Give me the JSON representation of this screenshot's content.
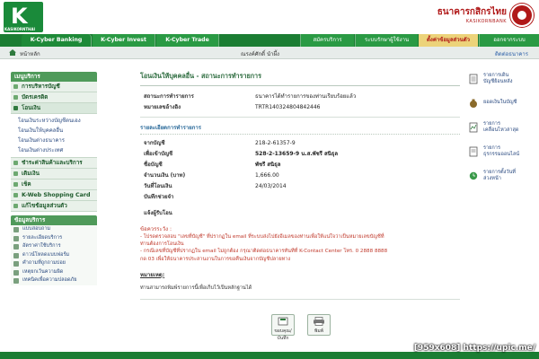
{
  "brand": {
    "logo_caption": "KASIKORNTHAI",
    "bank_name_th": "ธนาคารกสิกรไทย",
    "bank_name_en": "KASIKORNBANK",
    "primary_color": "#1b7d33",
    "accent_color": "#b01818"
  },
  "tabs": [
    {
      "label": "K-Cyber Banking"
    },
    {
      "label": "K-Cyber Invest"
    },
    {
      "label": "K-Cyber Trade"
    }
  ],
  "top_links": [
    {
      "label": "สมัครบริการ"
    },
    {
      "label": "ระบบรักษาผู้ใช้งาน"
    },
    {
      "label": "ตั้งค่าข้อมูลส่วนตัว"
    },
    {
      "label": "ออกจากระบบ"
    }
  ],
  "subbar": {
    "home": "หน้าหลัก",
    "user": "ณรงค์ศักดิ์ นำผึ้ง",
    "contact": "ติดต่อธนาคาร"
  },
  "sidebar": {
    "heading": "เมนูบริการ",
    "items": [
      {
        "label": "การบริหารบัญชี"
      },
      {
        "label": "บัตรเครดิต"
      },
      {
        "label": "โอนเงิน"
      }
    ],
    "transfer_sub": [
      {
        "label": "โอนเงินระหว่างบัญชีตนเอง"
      },
      {
        "label": "โอนเงินให้บุคคลอื่น"
      },
      {
        "label": "โอนเงินต่างธนาคาร"
      },
      {
        "label": "โอนเงินต่างประเทศ"
      }
    ],
    "items2": [
      {
        "label": "ชำระค่าสินค้าและบริการ"
      },
      {
        "label": "เติมเงิน"
      },
      {
        "label": "เช็ค"
      },
      {
        "label": "K-Web Shopping Card"
      },
      {
        "label": "แก้ไขข้อมูลส่วนตัว"
      }
    ],
    "info_heading": "ข้อมูลบริการ",
    "info_items": [
      {
        "label": "แบบสอบถาม"
      },
      {
        "label": "รายละเอียดบริการ"
      },
      {
        "label": "อัตราค่าใช้บริการ"
      },
      {
        "label": "ดาวน์โหลดแบบฟอร์ม"
      },
      {
        "label": "คำถามที่ถูกถามบ่อย"
      },
      {
        "label": "เหตุยกเว้นความผิด"
      },
      {
        "label": "เทคนิคเพื่อความปลอดภัย"
      }
    ]
  },
  "main": {
    "title": "โอนเงินให้บุคคลอื่น - สถานะการทำรายการ",
    "status_label": "สถานะการทำรายการ",
    "status_value": "ธนาคารได้ทำรายการของท่านเรียบร้อยแล้ว",
    "ref_label": "หมายเลขอ้างอิง",
    "ref_value": "TRTR140324804842446",
    "detail_heading": "รายละเอียดการทำรายการ",
    "details": [
      {
        "label": "จากบัญชี",
        "value": "218-2-61357-9",
        "bold": false
      },
      {
        "label": "เพื่อเข้าบัญชี",
        "value": "528-2-13659-9 น.ส.พัชรี สนิธุล",
        "bold": true
      },
      {
        "label": "ชื่อบัญชี",
        "value": "พัชรี สนิธุล",
        "bold": true
      },
      {
        "label": "จำนวนเงิน (บาท)",
        "value": "1,666.00",
        "bold": false
      },
      {
        "label": "วันที่โอนเงิน",
        "value": "24/03/2014",
        "bold": false
      },
      {
        "label": "บันทึกช่วยจำ",
        "value": "",
        "bold": false
      }
    ],
    "notify_label": "แจ้งผู้รับโอน",
    "notice_title": "ข้อควรระวัง :",
    "notice_lines": [
      "- โปรดตรวจสอบ \"เลขที่บัญชี\" ที่ปรากฏใน email ที่ระบบส่งไปยังอีเมลของท่านเพื่อให้แน่ใจว่าเป็นหมายเลขบัญชีที่",
      "ท่านต้องการโอนเงิน",
      "- กรณีเลขที่บัญชีที่ปรากฏใน email ไม่ถูกต้อง กรุณาติดต่อธนาคารทันทีที่ K-Contact Center โทร. 0 2888 8888",
      "กด 03 เพื่อให้ธนาคารประสานงานในการขอคืนเงินจากบัญชีปลายทาง"
    ],
    "note_head": "หมายเหตุ:",
    "note_body": "ท่านสามารถพิมพ์รายการนี้เพื่อเก็บไว้เป็นหลักฐานได้",
    "btn_save": "ขอบคุณ/บันทึก",
    "btn_print": "พิมพ์"
  },
  "right_panel": [
    {
      "label1": "รายการเดิน",
      "label2": "บัญชีย้อนหลัง"
    },
    {
      "label1": "ยอดเงินในบัญชี",
      "label2": ""
    },
    {
      "label1": "รายการ",
      "label2": "เคลื่อนไหวล่าสุด"
    },
    {
      "label1": "รายการ",
      "label2": "ธุรกรรมออนไลน์"
    },
    {
      "label1": "รายการตั้งวันที่",
      "label2": "ล่วงหน้า"
    }
  ],
  "watermark": "[959x608] https://upic.me/"
}
